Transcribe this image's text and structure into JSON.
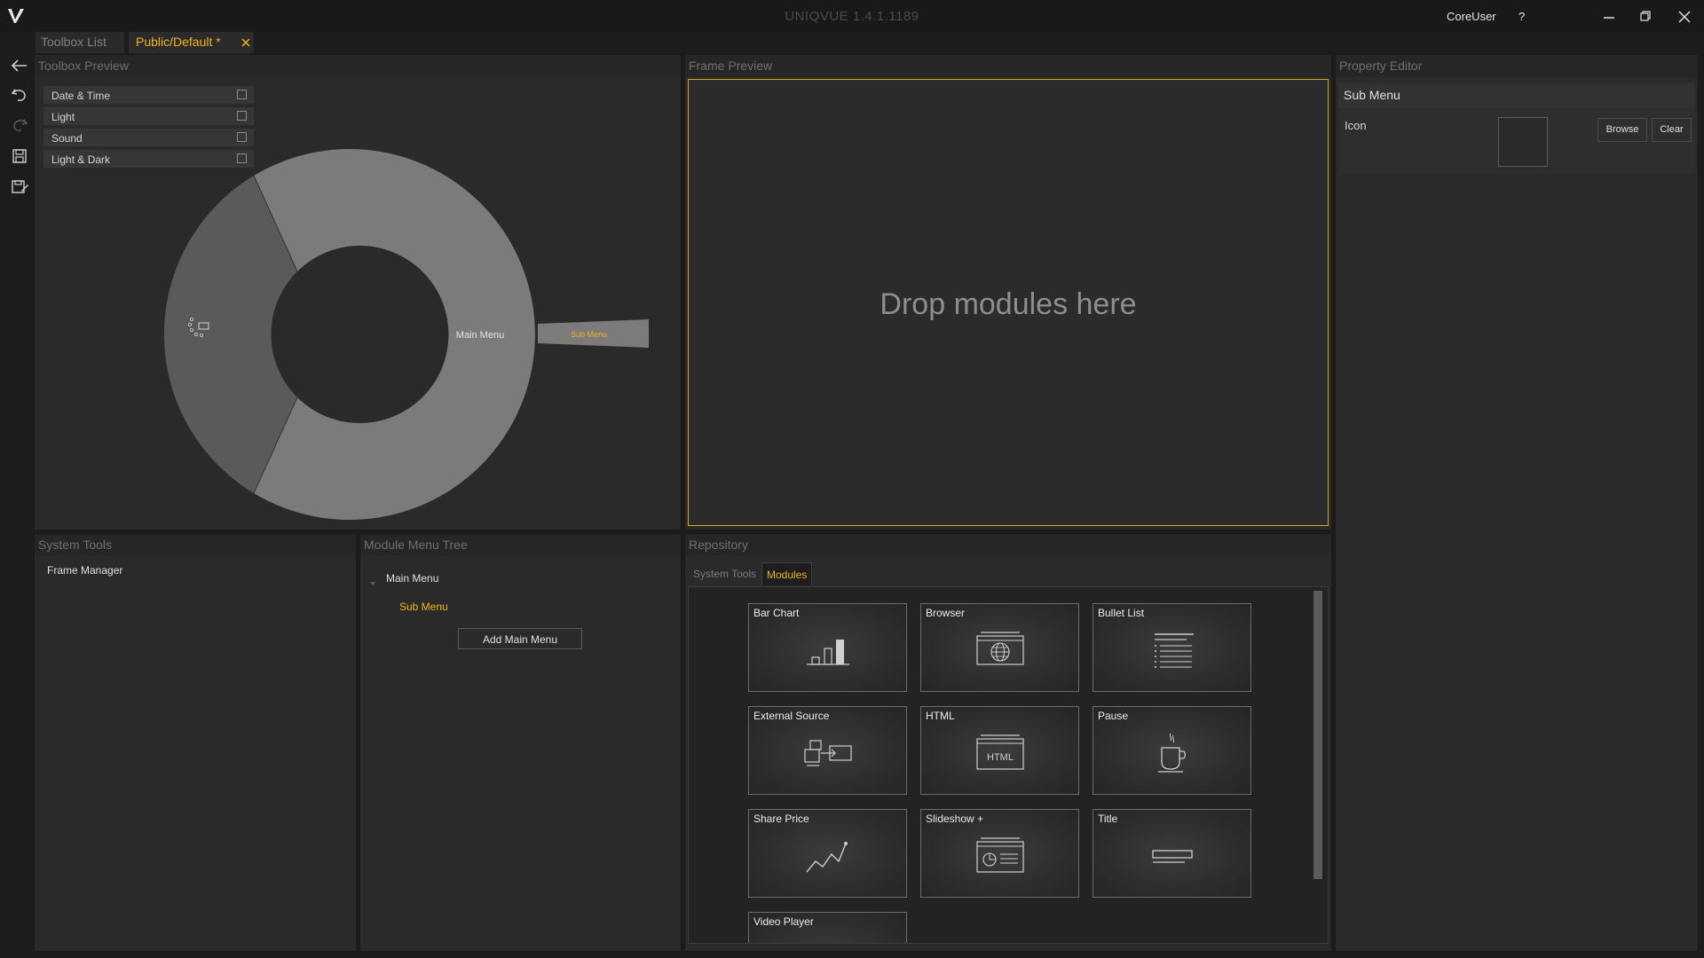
{
  "window": {
    "title": "UNIQVUE 1.4.1.1189",
    "user": "CoreUser",
    "help": "?"
  },
  "tabs": [
    {
      "label": "Toolbox List",
      "active": false
    },
    {
      "label": "Public/Default *",
      "active": true
    }
  ],
  "toolbox_preview": {
    "title": "Toolbox Preview",
    "items": [
      {
        "label": "Date & Time",
        "checked": false
      },
      {
        "label": "Light",
        "checked": false
      },
      {
        "label": "Sound",
        "checked": false
      },
      {
        "label": "Light & Dark",
        "checked": false
      }
    ],
    "ring": {
      "main_label": "Main Menu",
      "sub_label": "Sub Menu"
    }
  },
  "frame_preview": {
    "title": "Frame Preview",
    "placeholder": "Drop modules here"
  },
  "property_editor": {
    "title": "Property Editor",
    "section": "Sub Menu",
    "icon_label": "Icon",
    "browse_label": "Browse",
    "clear_label": "Clear"
  },
  "system_tools": {
    "title": "System Tools",
    "items": [
      "Frame Manager"
    ]
  },
  "module_menu_tree": {
    "title": "Module Menu Tree",
    "main": "Main Menu",
    "sub": "Sub Menu",
    "add_label": "Add Main Menu"
  },
  "repository": {
    "title": "Repository",
    "tabs": [
      {
        "label": "System Tools",
        "active": false
      },
      {
        "label": "Modules",
        "active": true
      }
    ],
    "modules": [
      {
        "label": "Bar Chart",
        "icon": "bar-chart-icon"
      },
      {
        "label": "Browser",
        "icon": "globe-icon"
      },
      {
        "label": "Bullet List",
        "icon": "bullet-list-icon"
      },
      {
        "label": "External Source",
        "icon": "external-source-icon"
      },
      {
        "label": "HTML",
        "icon": "html-icon"
      },
      {
        "label": "Pause",
        "icon": "coffee-cup-icon"
      },
      {
        "label": "Share Price",
        "icon": "line-trend-icon"
      },
      {
        "label": "Slideshow +",
        "icon": "slideshow-icon"
      },
      {
        "label": "Title",
        "icon": "title-icon"
      },
      {
        "label": "Video Player",
        "icon": "video-icon"
      }
    ],
    "html_icon_text": "HTML"
  },
  "colors": {
    "accent": "#f2b31c",
    "panel": "#2a2a2a",
    "background": "#1c1c1c"
  }
}
